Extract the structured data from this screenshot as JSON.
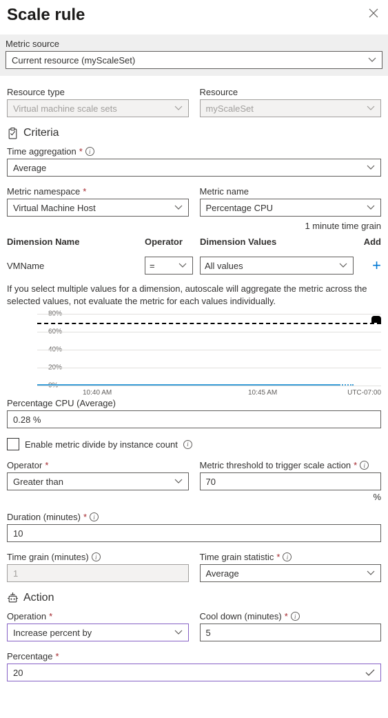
{
  "title": "Scale rule",
  "metricSource": {
    "label": "Metric source",
    "value": "Current resource (myScaleSet)"
  },
  "resourceType": {
    "label": "Resource type",
    "value": "Virtual machine scale sets"
  },
  "resource": {
    "label": "Resource",
    "value": "myScaleSet"
  },
  "criteria": {
    "heading": "Criteria"
  },
  "timeAgg": {
    "label": "Time aggregation",
    "value": "Average"
  },
  "metricNs": {
    "label": "Metric namespace",
    "value": "Virtual Machine Host"
  },
  "metricName": {
    "label": "Metric name",
    "value": "Percentage CPU"
  },
  "timeGrainNote": "1 minute time grain",
  "dimHeaders": {
    "name": "Dimension Name",
    "op": "Operator",
    "vals": "Dimension Values",
    "add": "Add"
  },
  "dimRow": {
    "name": "VMName",
    "op": "=",
    "vals": "All values"
  },
  "dimNote": "If you select multiple values for a dimension, autoscale will aggregate the metric across the selected values, not evaluate the metric for each values individually.",
  "chart_data": {
    "type": "line",
    "title": "",
    "xlabel": "",
    "ylabel": "",
    "ylim": [
      0,
      80
    ],
    "yticks": [
      "0%",
      "20%",
      "40%",
      "60%",
      "80%"
    ],
    "xticks": [
      "10:40 AM",
      "10:45 AM"
    ],
    "tz": "UTC-07:00",
    "threshold": 70,
    "series": [
      {
        "name": "Percentage CPU",
        "approx_value": 0.28
      }
    ]
  },
  "cpuAvg": {
    "label": "Percentage CPU (Average)",
    "value": "0.28 %"
  },
  "enableDivide": {
    "label": "Enable metric divide by instance count",
    "checked": false
  },
  "operator": {
    "label": "Operator",
    "value": "Greater than"
  },
  "threshold": {
    "label": "Metric threshold to trigger scale action",
    "value": "70",
    "unit": "%"
  },
  "duration": {
    "label": "Duration (minutes)",
    "value": "10"
  },
  "timeGrain": {
    "label": "Time grain (minutes)",
    "value": "1"
  },
  "timeGrainStat": {
    "label": "Time grain statistic",
    "value": "Average"
  },
  "action": {
    "heading": "Action"
  },
  "operation": {
    "label": "Operation",
    "value": "Increase percent by"
  },
  "cooldown": {
    "label": "Cool down (minutes)",
    "value": "5"
  },
  "percentage": {
    "label": "Percentage",
    "value": "20"
  }
}
